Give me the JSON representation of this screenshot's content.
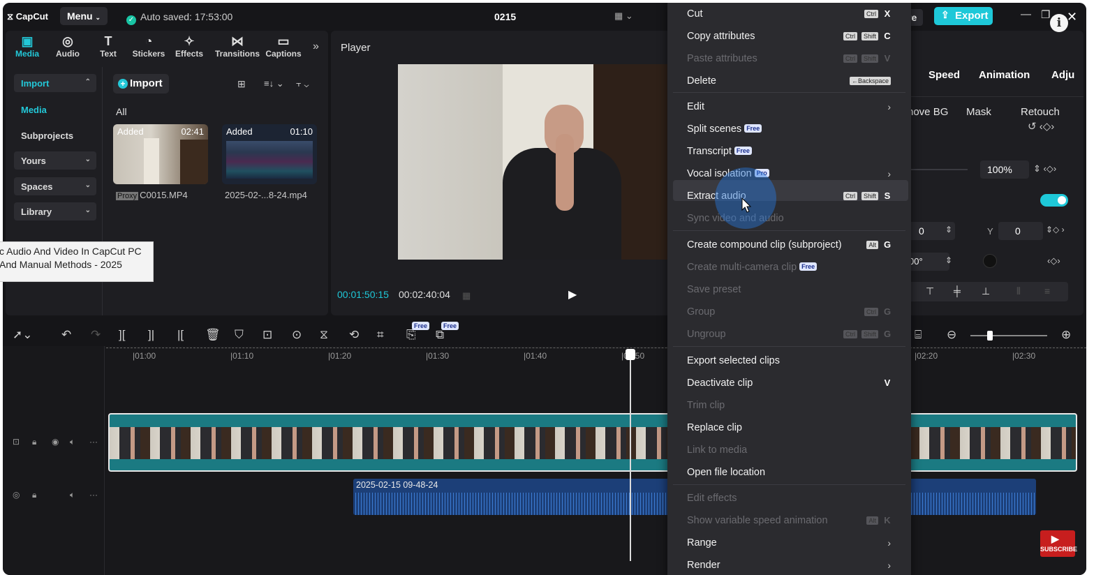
{
  "topbar": {
    "logo": "CapCut",
    "menu_label": "Menu",
    "autosave": "Auto saved: 17:53:00",
    "project_title": "0215",
    "share_fragment": "re",
    "export_label": "Export"
  },
  "left_tabs": [
    {
      "label": "Media",
      "icon": "media-icon"
    },
    {
      "label": "Audio",
      "icon": "audio-icon"
    },
    {
      "label": "Text",
      "icon": "text-icon"
    },
    {
      "label": "Stickers",
      "icon": "stickers-icon"
    },
    {
      "label": "Effects",
      "icon": "effects-icon"
    },
    {
      "label": "Transitions",
      "icon": "transitions-icon"
    },
    {
      "label": "Captions",
      "icon": "captions-icon"
    }
  ],
  "media_sidebar": {
    "import": "Import",
    "media": "Media",
    "subprojects": "Subprojects",
    "yours": "Yours",
    "spaces": "Spaces",
    "library": "Library"
  },
  "media_panel": {
    "import_button": "Import",
    "filter_all": "All",
    "items": [
      {
        "tag": "Added",
        "duration": "02:41",
        "proxy": "Proxy",
        "name": "C0015.MP4"
      },
      {
        "tag": "Added",
        "duration": "01:10",
        "name": "2025-02-...8-24.mp4"
      }
    ]
  },
  "tooltip": {
    "line1": "c Audio And Video In CapCut PC",
    "line2": "And Manual Methods - 2025"
  },
  "player": {
    "title": "Player",
    "current_time": "00:01:50:15",
    "total_time": "00:02:40:04"
  },
  "right_panel": {
    "tabs": [
      "Speed",
      "Animation",
      "Adju"
    ],
    "subtabs": [
      "nove BG",
      "Mask",
      "Retouch"
    ],
    "scale_value": "100%",
    "x_value": "0",
    "y_label": "Y",
    "y_value": "0",
    "rotation_value": "00°"
  },
  "context_menu": {
    "items": [
      {
        "label": "Cut",
        "keys": [
          "Ctrl"
        ],
        "letter": "X",
        "disabled": false
      },
      {
        "label": "Copy attributes",
        "keys": [
          "Ctrl",
          "Shift"
        ],
        "letter": "C",
        "disabled": false
      },
      {
        "label": "Paste attributes",
        "keys": [
          "Ctrl",
          "Shift"
        ],
        "letter": "V",
        "disabled": true
      },
      {
        "label": "Delete",
        "keys": [
          "←Backspace"
        ],
        "letter": "",
        "disabled": false
      },
      {
        "label": "Edit",
        "submenu": true,
        "disabled": false
      },
      {
        "label": "Split scenes",
        "badge": "Free",
        "disabled": false
      },
      {
        "label": "Transcript",
        "badge": "Free",
        "disabled": false
      },
      {
        "label": "Vocal isolation",
        "badge": "Pro",
        "submenu": true,
        "disabled": false
      },
      {
        "label": "Extract audio",
        "keys": [
          "Ctrl",
          "Shift"
        ],
        "letter": "S",
        "disabled": false,
        "highlighted": true
      },
      {
        "label": "Sync video and audio",
        "disabled": true
      },
      {
        "label": "Create compound clip (subproject)",
        "keys": [
          "Alt"
        ],
        "letter": "G",
        "disabled": false
      },
      {
        "label": "Create multi-camera clip",
        "badge": "Free",
        "disabled": true
      },
      {
        "label": "Save preset",
        "disabled": true
      },
      {
        "label": "Group",
        "keys": [
          "Ctrl"
        ],
        "letter": "G",
        "disabled": true
      },
      {
        "label": "Ungroup",
        "keys": [
          "Ctrl",
          "Shift"
        ],
        "letter": "G",
        "disabled": true
      },
      {
        "label": "Export selected clips",
        "disabled": false
      },
      {
        "label": "Deactivate clip",
        "letter": "V",
        "disabled": false
      },
      {
        "label": "Trim clip",
        "disabled": true
      },
      {
        "label": "Replace clip",
        "disabled": false
      },
      {
        "label": "Link to media",
        "disabled": true
      },
      {
        "label": "Open file location",
        "disabled": false
      },
      {
        "label": "Edit effects",
        "disabled": true
      },
      {
        "label": "Show variable speed animation",
        "keys": [
          "Alt"
        ],
        "letter": "K",
        "disabled": true
      },
      {
        "label": "Range",
        "submenu": true,
        "disabled": false
      },
      {
        "label": "Render",
        "submenu": true,
        "disabled": false
      }
    ]
  },
  "timeline": {
    "free_badge": "Free",
    "ruler": [
      "|01:00",
      "|01:10",
      "|01:20",
      "|01:30",
      "|01:40",
      "|01:50",
      "|02:20",
      "|02:30"
    ],
    "audio_clip_name": "2025-02-15 09-48-24"
  },
  "subscribe": "SUBSCRIBE"
}
